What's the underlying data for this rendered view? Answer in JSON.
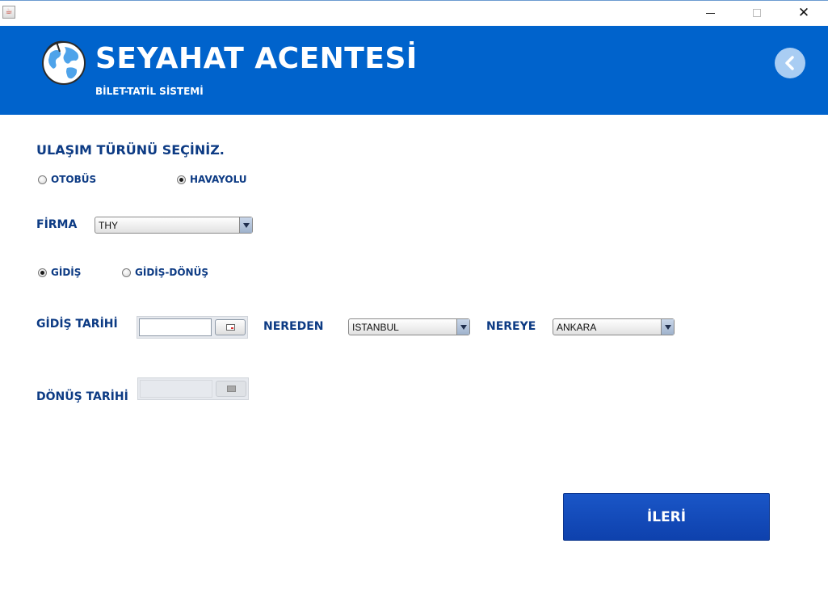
{
  "window": {
    "minimize_icon": "minimize-icon",
    "maximize_icon": "maximize-icon",
    "close_glyph": "✕"
  },
  "header": {
    "title": "SEYAHAT ACENTESİ",
    "subtitle": "BİLET-TATİL SİSTEMİ",
    "logo_icon": "globe-icon",
    "back_icon": "chevron-left-icon",
    "background_color": "#0063cc"
  },
  "form": {
    "transport_title": "ULAŞIM TÜRÜNÜ SEÇİNİZ.",
    "transport_options": [
      {
        "label": "OTOBÜS",
        "selected": false
      },
      {
        "label": "HAVAYOLU",
        "selected": true
      }
    ],
    "company_label": "FİRMA",
    "company_value": "THY",
    "trip_options": [
      {
        "label": "GİDİŞ",
        "selected": true
      },
      {
        "label": "GİDİŞ-DÖNÜŞ",
        "selected": false
      }
    ],
    "departure_date_label": "GİDİŞ TARİHİ",
    "departure_date_value": "",
    "from_label": "NEREDEN",
    "from_value": "ISTANBUL",
    "to_label": "NEREYE",
    "to_value": "ANKARA",
    "return_date_label": "DÖNÜŞ TARİHİ",
    "return_date_value": "",
    "return_date_enabled": false,
    "label_color": "#0d3b84"
  },
  "actions": {
    "next_label": "İLERİ",
    "next_color": "#1450bd"
  }
}
